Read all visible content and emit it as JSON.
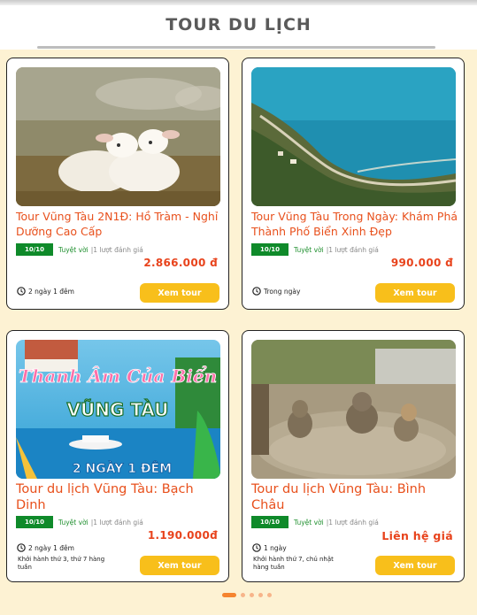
{
  "section": {
    "title": "TOUR DU LỊCH"
  },
  "tours": [
    {
      "name": "Tour Vũng Tàu 2N1Đ: Hồ Tràm - Nghỉ Dưỡng Cao Cấp",
      "score": "10/10",
      "quality": "Tuyệt vời",
      "reviews": "|1 lượt đánh giá",
      "price": "2.866.000 đ",
      "duration": "2 ngày 1 đêm",
      "button": "Xem tour",
      "image": "sheep-photo"
    },
    {
      "name": "Tour Vũng Tàu Trong Ngày: Khám Phá Thành Phố Biển Xinh Đẹp",
      "score": "10/10",
      "quality": "Tuyệt vời",
      "reviews": "|1 lượt đánh giá",
      "price": "990.000 đ",
      "duration": "Trong ngày",
      "button": "Xem tour",
      "image": "coast-photo"
    },
    {
      "name": "Tour du lịch Vũng Tàu: Bạch Dinh",
      "score": "10/10",
      "quality": "Tuyệt vời",
      "reviews": "|1 lượt đánh giá",
      "price": "1.190.000đ",
      "duration": "2 ngày 1 đêm",
      "departure": "Khởi hành thứ 3, thứ 7 hàng tuần",
      "button": "Xem tour",
      "image": "poster-photo",
      "poster": {
        "line1": "Thanh Âm Của Biển",
        "line2": "VŨNG TÀU",
        "line3": "2 NGÀY 1 ĐÊM"
      }
    },
    {
      "name": "Tour du lịch Vũng Tàu: Bình Châu",
      "score": "10/10",
      "quality": "Tuyệt vời",
      "reviews": "|1 lượt đánh giá",
      "price": "Liên hệ giá",
      "duration": "1 ngày",
      "departure": "Khởi hành thứ 7, chủ nhật hàng tuần",
      "button": "Xem tour",
      "image": "mud-bath-photo"
    }
  ],
  "pagination": {
    "pages": 5,
    "active": 1
  },
  "colors": {
    "accent": "#e8501c",
    "button": "#f8bf1b",
    "rating": "#0f8a2a",
    "panel": "#fdf2d3"
  }
}
